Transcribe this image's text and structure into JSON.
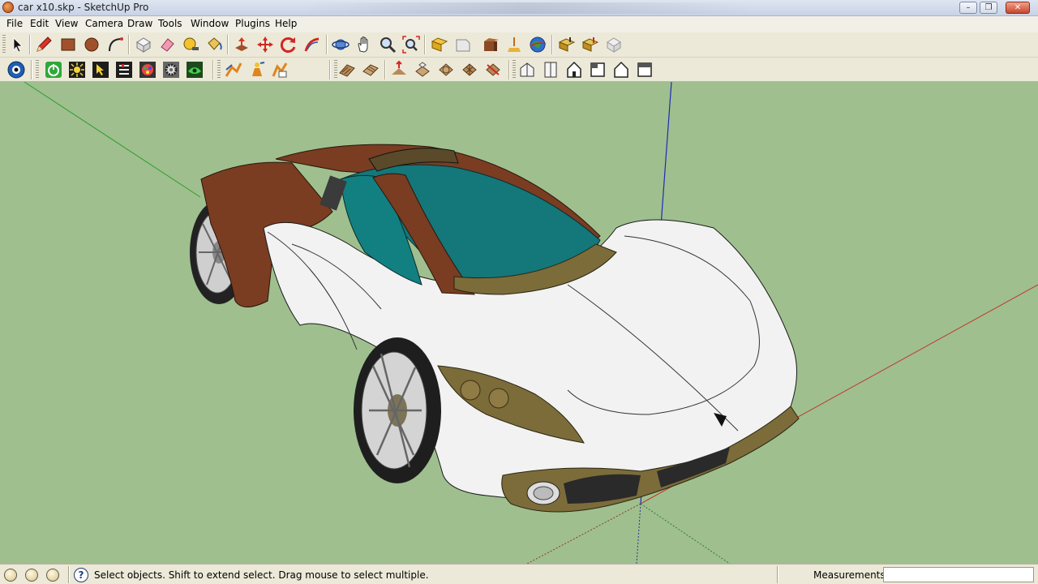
{
  "window": {
    "title": "car x10.skp - SketchUp Pro"
  },
  "menu": [
    "File",
    "Edit",
    "View",
    "Camera",
    "Draw",
    "Tools",
    "Window",
    "Plugins",
    "Help"
  ],
  "toolbar1": [
    "select-tool",
    "pencil-line-tool",
    "rectangle-tool",
    "circle-tool",
    "arc-tool",
    "make-component-tool",
    "eraser-tool",
    "tape-measure-tool",
    "paint-bucket-tool",
    "push-pull-tool",
    "move-tool",
    "rotate-tool",
    "follow-me-tool",
    "orbit-tool",
    "pan-tool",
    "zoom-tool",
    "zoom-extents-tool",
    "get-models-tool",
    "share-model-tool",
    "add-location-tool",
    "toggle-terrain-tool",
    "google-earth-tool",
    "get-components-tool",
    "share-component-tool",
    "layout-tool"
  ],
  "toolbar2": [
    "standard-views-tool",
    "power-tool",
    "sun-tool",
    "cursor-tool",
    "options-tool",
    "palette-tool",
    "gear-tool",
    "render-tool",
    "plugin-tool-1",
    "plugin-tool-2",
    "plugin-tool-3",
    "sandbox-from-contours-tool",
    "sandbox-from-scratch-tool",
    "smoove-tool",
    "stamp-tool",
    "drape-tool",
    "add-detail-tool",
    "flip-edge-tool",
    "iso-view-tool",
    "top-view-tool",
    "front-view-tool",
    "right-view-tool",
    "back-view-tool",
    "left-view-tool"
  ],
  "status": {
    "message": "Select objects. Shift to extend select. Drag mouse to select multiple.",
    "measurements_label": "Measurements",
    "measurements_value": ""
  },
  "colors": {
    "background": "#9fbf8f",
    "body_white": "#f2f2f2",
    "body_brown": "#7a3d22",
    "glass_teal": "#14777a",
    "trim_olive": "#7b6c3a",
    "axis_red": "#c0392b",
    "axis_green": "#2e9e2e",
    "axis_blue": "#1f2bb5"
  }
}
